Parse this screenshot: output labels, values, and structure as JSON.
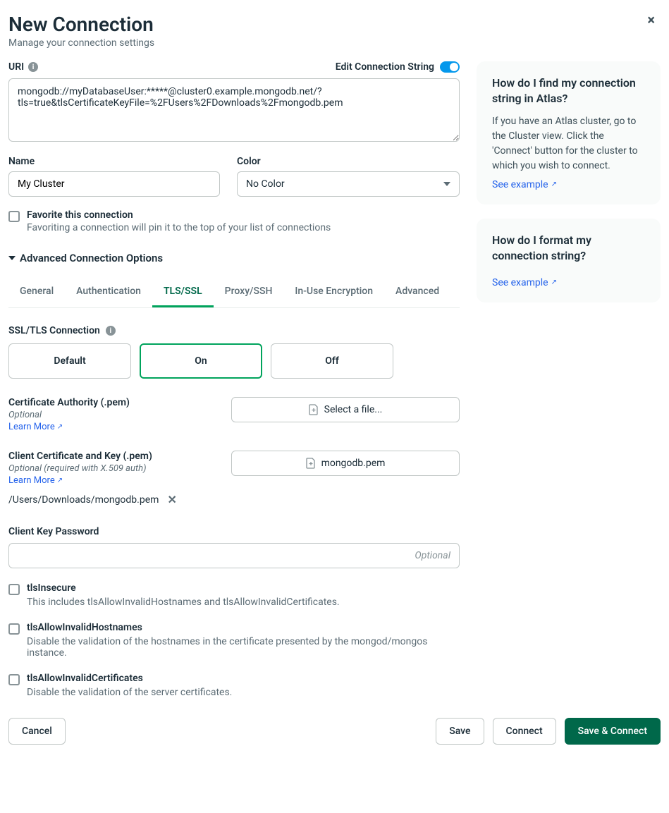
{
  "header": {
    "title": "New Connection",
    "subtitle": "Manage your connection settings",
    "close_label": "×"
  },
  "uri": {
    "label": "URI",
    "edit_label": "Edit Connection String",
    "value": "mongodb://myDatabaseUser:*****@cluster0.example.mongodb.net/?tls=true&tlsCertificateKeyFile=%2FUsers%2FDownloads%2Fmongodb.pem"
  },
  "name": {
    "label": "Name",
    "value": "My Cluster"
  },
  "color": {
    "label": "Color",
    "value": "No Color"
  },
  "favorite": {
    "title": "Favorite this connection",
    "desc": "Favoriting a connection will pin it to the top of your list of connections"
  },
  "advanced_header": "Advanced Connection Options",
  "tabs": {
    "general": "General",
    "authentication": "Authentication",
    "tlsssl": "TLS/SSL",
    "proxyssh": "Proxy/SSH",
    "inuse": "In-Use Encryption",
    "advanced": "Advanced"
  },
  "ssl_section": {
    "label": "SSL/TLS Connection",
    "options": {
      "default": "Default",
      "on": "On",
      "off": "Off"
    }
  },
  "ca": {
    "title": "Certificate Authority (.pem)",
    "optional": "Optional",
    "learn_more": "Learn More",
    "select_file": "Select a file..."
  },
  "client_cert": {
    "title": "Client Certificate and Key (.pem)",
    "optional": "Optional (required with X.509 auth)",
    "learn_more": "Learn More",
    "filename": "mongodb.pem",
    "filepath": "/Users/Downloads/mongodb.pem"
  },
  "client_key_password": {
    "label": "Client Key Password",
    "placeholder": "Optional"
  },
  "tls_insecure": {
    "title": "tlsInsecure",
    "desc": "This includes tlsAllowInvalidHostnames and tlsAllowInvalidCertificates."
  },
  "tls_hostnames": {
    "title": "tlsAllowInvalidHostnames",
    "desc": "Disable the validation of the hostnames in the certificate presented by the mongod/mongos instance."
  },
  "tls_certs": {
    "title": "tlsAllowInvalidCertificates",
    "desc": "Disable the validation of the server certificates."
  },
  "help": {
    "card1_title": "How do I find my connection string in Atlas?",
    "card1_body": "If you have an Atlas cluster, go to the Cluster view. Click the 'Connect' button for the cluster to which you wish to connect.",
    "card2_title": "How do I format my connection string?",
    "see_example": "See example"
  },
  "footer": {
    "cancel": "Cancel",
    "save": "Save",
    "connect": "Connect",
    "save_connect": "Save & Connect"
  }
}
